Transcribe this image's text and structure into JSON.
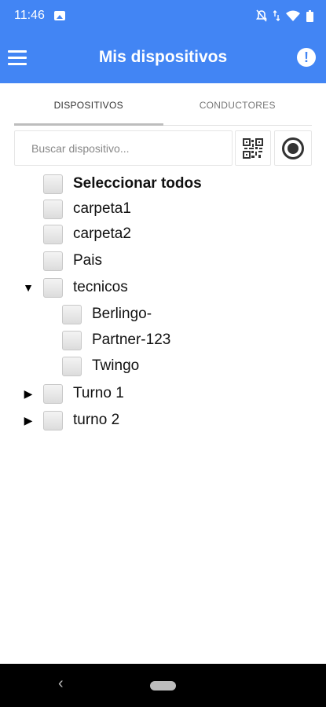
{
  "status_bar": {
    "time": "11:46",
    "icons": [
      "image-icon",
      "mute-icon",
      "data-arrows-icon",
      "wifi-icon",
      "battery-icon"
    ]
  },
  "app_bar": {
    "title": "Mis dispositivos",
    "menu_icon": "hamburger-menu-icon",
    "info_icon": "info-icon",
    "info_glyph": "!"
  },
  "tabs": [
    {
      "label": "DISPOSITIVOS",
      "active": true
    },
    {
      "label": "CONDUCTORES",
      "active": false
    }
  ],
  "search": {
    "placeholder": "Buscar dispositivo..."
  },
  "tree": {
    "select_all": "Seleccionar todos",
    "items": [
      {
        "label": "carpeta1"
      },
      {
        "label": "carpeta2"
      },
      {
        "label": "Pais"
      },
      {
        "label": "tecnicos",
        "expanded": true,
        "children": [
          {
            "label": "Berlingo-"
          },
          {
            "label": "Partner-123"
          },
          {
            "label": "Twingo"
          }
        ]
      },
      {
        "label": "Turno 1",
        "expanded": false
      },
      {
        "label": "turno 2",
        "expanded": false
      }
    ],
    "expanded_arrow": "▼",
    "collapsed_arrow": "▶"
  },
  "colors": {
    "primary": "#4285f4",
    "navbar": "#000000"
  }
}
